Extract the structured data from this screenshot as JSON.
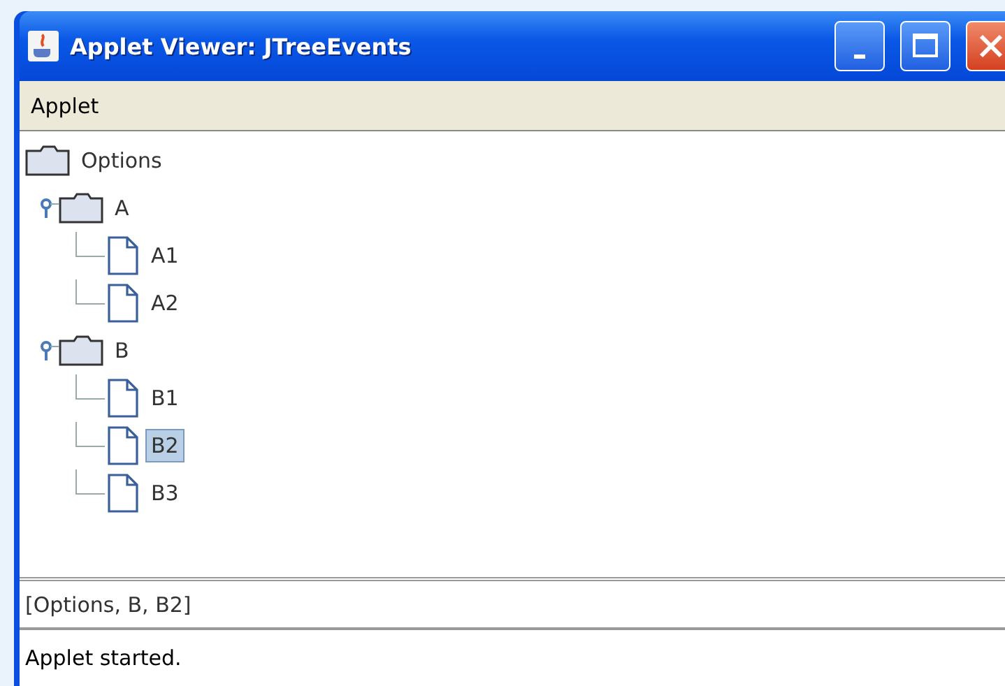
{
  "window": {
    "title": "Applet Viewer: JTreeEvents"
  },
  "menu_bar": [
    "Applet"
  ],
  "tree": [
    {
      "label": "Options",
      "kind": "folder",
      "selected": false,
      "expanded": true,
      "children": [
        {
          "label": "A",
          "kind": "folder",
          "selected": false,
          "expanded": true,
          "children": [
            {
              "label": "A1",
              "kind": "leaf",
              "selected": false
            },
            {
              "label": "A2",
              "kind": "leaf",
              "selected": false
            }
          ]
        },
        {
          "label": "B",
          "kind": "folder",
          "selected": false,
          "expanded": true,
          "children": [
            {
              "label": "B1",
              "kind": "leaf",
              "selected": false
            },
            {
              "label": "B2",
              "kind": "leaf",
              "selected": true
            },
            {
              "label": "B3",
              "kind": "leaf",
              "selected": false
            }
          ]
        }
      ]
    }
  ],
  "path_field": {
    "value": "[Options, B, B2]"
  },
  "status_bar": "Applet started."
}
